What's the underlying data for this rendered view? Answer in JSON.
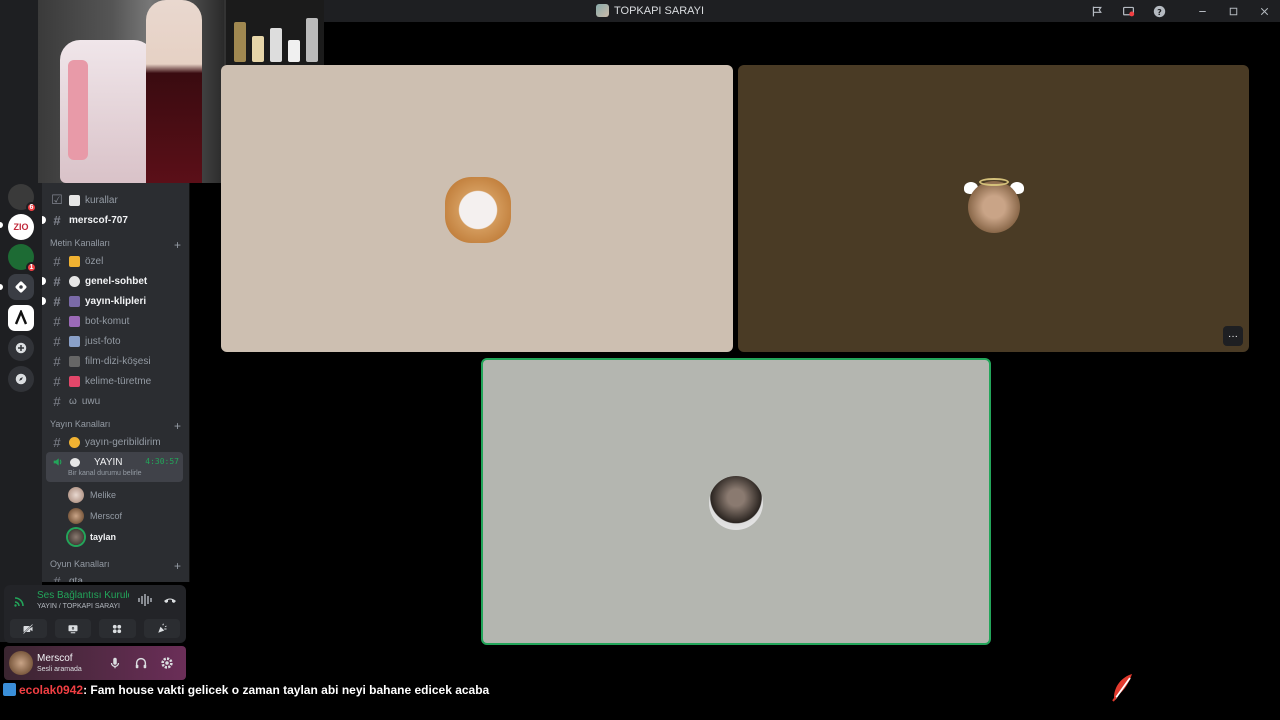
{
  "window": {
    "title": "TOPKAPI SARAYI"
  },
  "titlebar_icons": [
    "flag-icon",
    "screen-share-icon",
    "help-icon",
    "minimize-icon",
    "maximize-icon",
    "close-icon"
  ],
  "server_rail": {
    "items": [
      {
        "name": "server-1",
        "badge": "6",
        "color": "#3a3a3a"
      },
      {
        "name": "server-zio",
        "label": "ZIO",
        "color": "#ffffff"
      },
      {
        "name": "server-green",
        "badge": "1",
        "color": "#1d6b34"
      },
      {
        "name": "server-game",
        "color": "#3a3d44"
      },
      {
        "name": "server-lambda",
        "color": "#ffffff"
      },
      {
        "name": "add-server",
        "color": "#313338"
      },
      {
        "name": "explore-servers",
        "color": "#313338"
      }
    ]
  },
  "channels": {
    "top": [
      {
        "label": "kurallar",
        "icon": "clipboard"
      },
      {
        "label": "merscof-707",
        "unread": true
      }
    ],
    "categories": [
      {
        "label": "Metin Kanalları"
      },
      {
        "label": "Yayın Kanalları"
      },
      {
        "label": "Oyun Kanalları"
      }
    ],
    "text": [
      {
        "label": "özel"
      },
      {
        "label": "genel-sohbet",
        "unread": true
      },
      {
        "label": "yayın-klipleri",
        "unread": true
      },
      {
        "label": "bot-komut"
      },
      {
        "label": "just-foto"
      },
      {
        "label": "film-dizi-köşesi"
      },
      {
        "label": "kelime-türetme"
      },
      {
        "label": "uwu",
        "prefix": "ω"
      }
    ],
    "stream": [
      {
        "label": "yayın-geribildirim"
      }
    ],
    "voice": {
      "label": "YAYIN",
      "timer": "4:30:57",
      "status": "Bir kanal durumu belirle",
      "users": [
        {
          "name": "Melike"
        },
        {
          "name": "Merscof"
        },
        {
          "name": "taylan",
          "speaking": true
        }
      ]
    },
    "game": [
      {
        "label": "gta"
      }
    ]
  },
  "voice_panel": {
    "title": "Ses Bağlantısı Kuruldu",
    "subtitle": "YAYIN / TOPKAPI SARAYI"
  },
  "user_panel": {
    "username": "Merscof",
    "status": "Sesli aramada"
  },
  "chat": {
    "user": "ecolak0942",
    "message": ": Fam house vakti gelicek o zaman taylan abi neyi bahane edicek acaba"
  }
}
